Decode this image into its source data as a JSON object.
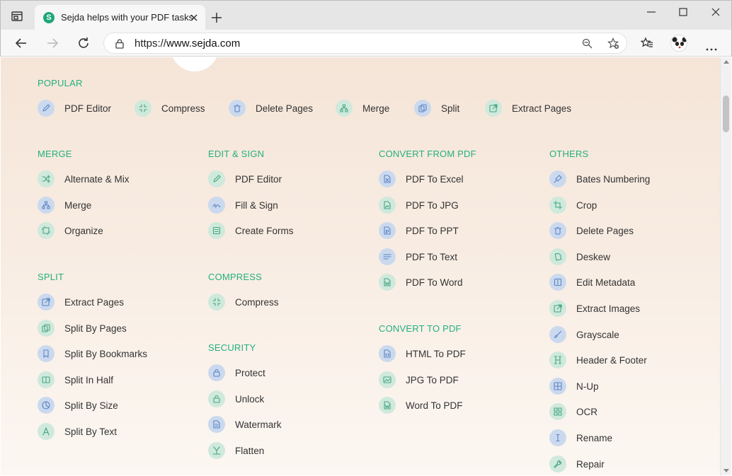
{
  "browser": {
    "tab_title": "Sejda helps with your PDF tasks",
    "favicon_letter": "S",
    "url_scheme": "https://",
    "url_host": "www.sejda.com"
  },
  "colors": {
    "accent": "#23b07d",
    "blue_icon": "#5a84c4",
    "green_icon": "#46a581"
  },
  "popular": {
    "heading": "POPULAR",
    "items": [
      {
        "label": "PDF Editor",
        "icon": "pencil-icon",
        "tone": "blue"
      },
      {
        "label": "Compress",
        "icon": "compress-icon",
        "tone": "green"
      },
      {
        "label": "Delete Pages",
        "icon": "trash-icon",
        "tone": "blue"
      },
      {
        "label": "Merge",
        "icon": "merge-icon",
        "tone": "green"
      },
      {
        "label": "Split",
        "icon": "split-icon",
        "tone": "blue"
      },
      {
        "label": "Extract Pages",
        "icon": "external-icon",
        "tone": "green"
      }
    ]
  },
  "merge": {
    "heading": "MERGE",
    "items": [
      {
        "label": "Alternate & Mix",
        "icon": "shuffle-icon",
        "tone": "green"
      },
      {
        "label": "Merge",
        "icon": "merge-icon",
        "tone": "blue"
      },
      {
        "label": "Organize",
        "icon": "organize-icon",
        "tone": "green"
      }
    ]
  },
  "split": {
    "heading": "SPLIT",
    "items": [
      {
        "label": "Extract Pages",
        "icon": "external-icon",
        "tone": "blue"
      },
      {
        "label": "Split By Pages",
        "icon": "split-icon",
        "tone": "green"
      },
      {
        "label": "Split By Bookmarks",
        "icon": "bookmark-icon",
        "tone": "blue"
      },
      {
        "label": "Split In Half",
        "icon": "half-icon",
        "tone": "green"
      },
      {
        "label": "Split By Size",
        "icon": "pie-icon",
        "tone": "blue"
      },
      {
        "label": "Split By Text",
        "icon": "text-a-icon",
        "tone": "green"
      }
    ]
  },
  "edit_sign": {
    "heading": "EDIT & SIGN",
    "items": [
      {
        "label": "PDF Editor",
        "icon": "pencil-icon",
        "tone": "green"
      },
      {
        "label": "Fill & Sign",
        "icon": "signature-icon",
        "tone": "blue"
      },
      {
        "label": "Create Forms",
        "icon": "form-icon",
        "tone": "green"
      }
    ]
  },
  "compress": {
    "heading": "COMPRESS",
    "items": [
      {
        "label": "Compress",
        "icon": "compress-icon",
        "tone": "green"
      }
    ]
  },
  "security": {
    "heading": "SECURITY",
    "items": [
      {
        "label": "Protect",
        "icon": "lock-icon",
        "tone": "blue"
      },
      {
        "label": "Unlock",
        "icon": "unlock-icon",
        "tone": "green"
      },
      {
        "label": "Watermark",
        "icon": "watermark-icon",
        "tone": "blue"
      },
      {
        "label": "Flatten",
        "icon": "flatten-icon",
        "tone": "green"
      }
    ]
  },
  "convert_from": {
    "heading": "CONVERT FROM PDF",
    "items": [
      {
        "label": "PDF To Excel",
        "icon": "excel-file-icon",
        "tone": "blue"
      },
      {
        "label": "PDF To JPG",
        "icon": "image-file-icon",
        "tone": "green"
      },
      {
        "label": "PDF To PPT",
        "icon": "ppt-file-icon",
        "tone": "blue"
      },
      {
        "label": "PDF To Text",
        "icon": "text-lines-icon",
        "tone": "blue"
      },
      {
        "label": "PDF To Word",
        "icon": "word-file-icon",
        "tone": "green"
      }
    ]
  },
  "convert_to": {
    "heading": "CONVERT TO PDF",
    "items": [
      {
        "label": "HTML To PDF",
        "icon": "html-file-icon",
        "tone": "blue"
      },
      {
        "label": "JPG To PDF",
        "icon": "image-icon",
        "tone": "green"
      },
      {
        "label": "Word To PDF",
        "icon": "word-file-icon",
        "tone": "green"
      }
    ]
  },
  "others": {
    "heading": "OTHERS",
    "items": [
      {
        "label": "Bates Numbering",
        "icon": "stamp-icon",
        "tone": "blue"
      },
      {
        "label": "Crop",
        "icon": "crop-icon",
        "tone": "green"
      },
      {
        "label": "Delete Pages",
        "icon": "trash-icon",
        "tone": "blue"
      },
      {
        "label": "Deskew",
        "icon": "deskew-icon",
        "tone": "green"
      },
      {
        "label": "Edit Metadata",
        "icon": "info-icon",
        "tone": "blue"
      },
      {
        "label": "Extract Images",
        "icon": "external-icon",
        "tone": "green"
      },
      {
        "label": "Grayscale",
        "icon": "brush-icon",
        "tone": "blue"
      },
      {
        "label": "Header & Footer",
        "icon": "header-icon",
        "tone": "green"
      },
      {
        "label": "N-Up",
        "icon": "grid-icon",
        "tone": "blue"
      },
      {
        "label": "OCR",
        "icon": "ocr-icon",
        "tone": "green"
      },
      {
        "label": "Rename",
        "icon": "cursor-icon",
        "tone": "blue"
      },
      {
        "label": "Repair",
        "icon": "wrench-icon",
        "tone": "green"
      }
    ]
  }
}
